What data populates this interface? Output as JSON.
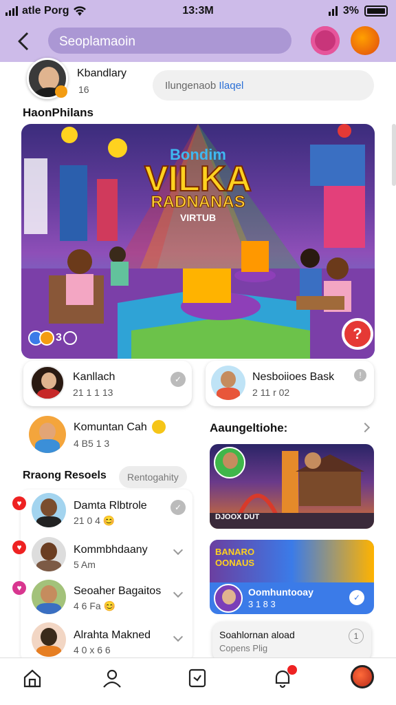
{
  "status_bar": {
    "carrier": "atle Porg",
    "time": "13:3M",
    "battery": "3%"
  },
  "header": {
    "search_placeholder": "Seoplamaoin"
  },
  "profile": {
    "name": "Kbandlary",
    "count": "16",
    "field_text": "Ilungenaob",
    "field_highlight": "Ilaqel"
  },
  "section_title": "HaonPhilans",
  "hero": {
    "title_top": "Bondim",
    "title_main": "VILKA",
    "title_sub": "RADNANAS",
    "title_tag": "VIRTUB",
    "reactions_count": "3",
    "colors": {
      "sky": "#6a3fa0",
      "floor": "#2fa3d6",
      "accent": "#ffd21f",
      "badge": "#e53935"
    }
  },
  "cards": [
    {
      "name": "Kanllach",
      "meta": "21 1 1 13"
    },
    {
      "name": "Nesboiioes Bask",
      "meta": "2 11 r 02"
    }
  ],
  "community": {
    "name": "Komuntan Cah",
    "meta": "4 B5 1 3"
  },
  "recent": {
    "title": "Rraong Resoels",
    "filter": "Rentogahity",
    "items": [
      {
        "name": "Damta Rlbtrole",
        "meta": "21 0 4",
        "emoji": "😊"
      },
      {
        "name": "Kommbhdaany",
        "meta": "5 Am",
        "emoji": ""
      },
      {
        "name": "Seoaher Bagaitos",
        "meta": "4 6 Fa",
        "emoji": "😊"
      },
      {
        "name": "Alrahta Makned",
        "meta": "4 0 x 6 6",
        "emoji": ""
      }
    ]
  },
  "right_section": {
    "title": "Aaungeltiohe:",
    "tile1_caption": "DJOOX DUT",
    "tile2_banner": "BANARO OONAUS",
    "tile2_name": "Oomhuntooay",
    "tile2_meta": "3 1 8 3",
    "tile3_name": "Soahlornan aload",
    "tile3_sub": "Copens Plig"
  },
  "nav": {
    "items": [
      "home-icon",
      "profile-icon",
      "message-icon",
      "notification-icon",
      "account-icon"
    ]
  }
}
